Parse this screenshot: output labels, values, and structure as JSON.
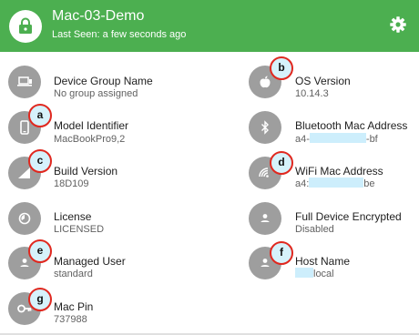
{
  "header": {
    "title": "Mac-03-Demo",
    "last_seen": "Last Seen: a few seconds ago",
    "lock_icon": "lock-icon",
    "settings_icon": "gear-icon",
    "color": "#4caf50"
  },
  "fields": [
    {
      "label": "Device Group Name",
      "value": "No group assigned",
      "icon": "laptop-icon"
    },
    {
      "label": "OS Version",
      "value": "10.14.3",
      "icon": "apple-icon"
    },
    {
      "label": "Model Identifier",
      "value": "MacBookPro9,2",
      "icon": "phone-icon"
    },
    {
      "label": "Bluetooth Mac Address",
      "value_start": "a4-",
      "value_end": "-bf",
      "icon": "bluetooth-icon"
    },
    {
      "label": "Build Version",
      "value": "18D109",
      "icon": "signal-icon"
    },
    {
      "label": "WiFi Mac Address",
      "value_start": "a4:",
      "value_end": "be",
      "icon": "wifi-icon"
    },
    {
      "label": "License",
      "value": "LICENSED",
      "icon": "license-icon"
    },
    {
      "label": "Full Device Encrypted",
      "value": "Disabled",
      "icon": "person-icon"
    },
    {
      "label": "Managed User",
      "value": "standard",
      "icon": "person-icon"
    },
    {
      "label": "Host Name",
      "value_end": "local",
      "icon": "person-icon"
    },
    {
      "label": "Mac Pin",
      "value": "737988",
      "icon": "key-icon"
    }
  ],
  "markers": [
    "a",
    "b",
    "c",
    "d",
    "e",
    "f",
    "g"
  ]
}
